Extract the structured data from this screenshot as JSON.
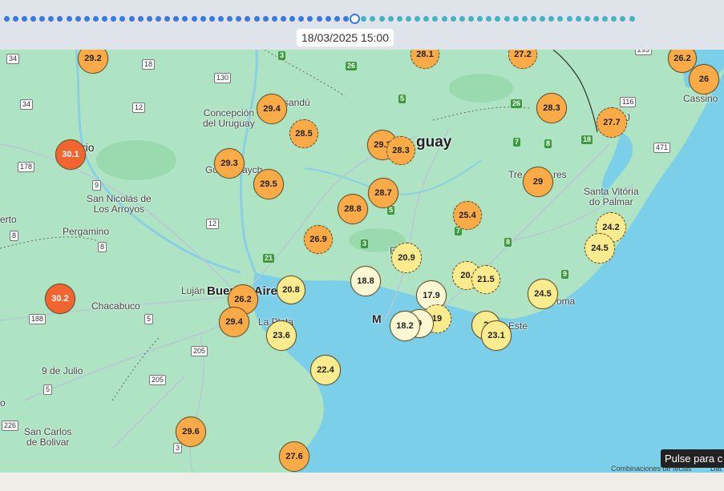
{
  "timeline": {
    "timestamp": "18/03/2025 15:00",
    "total_steps": 71,
    "current_step": 39,
    "colors": {
      "past": "#3b79e0",
      "future": "#45b3c2"
    }
  },
  "marker_colors": {
    "hot": "#f26430",
    "warm": "#fbaa48",
    "mild": "#faeb8e",
    "cool": "#fdf7d4"
  },
  "markers": [
    {
      "value": "29.2"
    },
    {
      "value": "28.1"
    },
    {
      "value": "27.2"
    },
    {
      "value": "26.2"
    },
    {
      "value": "26"
    },
    {
      "value": "30.1"
    },
    {
      "value": "29.4"
    },
    {
      "value": "28.5"
    },
    {
      "value": "28.3"
    },
    {
      "value": "27.7"
    },
    {
      "value": "29.3"
    },
    {
      "value": "29.2"
    },
    {
      "value": "28.3"
    },
    {
      "value": "29.5"
    },
    {
      "value": "28.7"
    },
    {
      "value": "28.8"
    },
    {
      "value": "29"
    },
    {
      "value": "25.4"
    },
    {
      "value": "24.2"
    },
    {
      "value": "26.9"
    },
    {
      "value": "24.5"
    },
    {
      "value": "20.9"
    },
    {
      "value": "18.8"
    },
    {
      "value": "20."
    },
    {
      "value": "21.5"
    },
    {
      "value": "20.8"
    },
    {
      "value": "17.9"
    },
    {
      "value": "24.5"
    },
    {
      "value": "30.2"
    },
    {
      "value": "26.2"
    },
    {
      "value": "29.4"
    },
    {
      "value": "19"
    },
    {
      "value": "9"
    },
    {
      "value": "18.2"
    },
    {
      "value": "2"
    },
    {
      "value": "23.1"
    },
    {
      "value": "23.6"
    },
    {
      "value": "22.4"
    },
    {
      "value": "29.6"
    },
    {
      "value": "27.6"
    }
  ],
  "places": {
    "paysandu": "sandú",
    "concepcion": "Concepción\ndel Uruguay",
    "uruguay": "guay",
    "rosario": "rio",
    "gualeguaychu": "Gu",
    "gualeguaychu2": "aych",
    "treinta": "Tre",
    "treinta2": "res",
    "santa_vitoria": "Santa Vitória\ndo Palmar",
    "san_nicolas": "San Nicolás de\nLos Arroyos",
    "erto": "erto",
    "pergamino": "Pergamino",
    "fray_bentos": "F",
    "lujan": "Luján",
    "buenos_aires": "Buenos Aire",
    "chacabuco": "Chacabuco",
    "la_plata": "La Plata",
    "montevideo": "M",
    "punta_del_este": "Este",
    "la_paloma": "oma",
    "cassino": "Cassino",
    "nueve_de_julio": "9 de Julio",
    "san_carlos": "San Carlos\nde Bolivar",
    "jaguarao": "J",
    "o_fragment": "o"
  },
  "shields": [
    "34",
    "18",
    "130",
    "12",
    "34",
    "178",
    "9",
    "8",
    "8",
    "12",
    "188",
    "5",
    "205",
    "205",
    "5",
    "226",
    "293",
    "116",
    "471",
    "3"
  ],
  "green_shields": [
    "3",
    "26",
    "5",
    "26",
    "7",
    "8",
    "18",
    "5",
    "7",
    "3",
    "21",
    "8",
    "9"
  ],
  "tooltip": "Pulse para c",
  "attribution": {
    "shortcuts": "Combinaciones de teclas",
    "data": "Dat"
  }
}
